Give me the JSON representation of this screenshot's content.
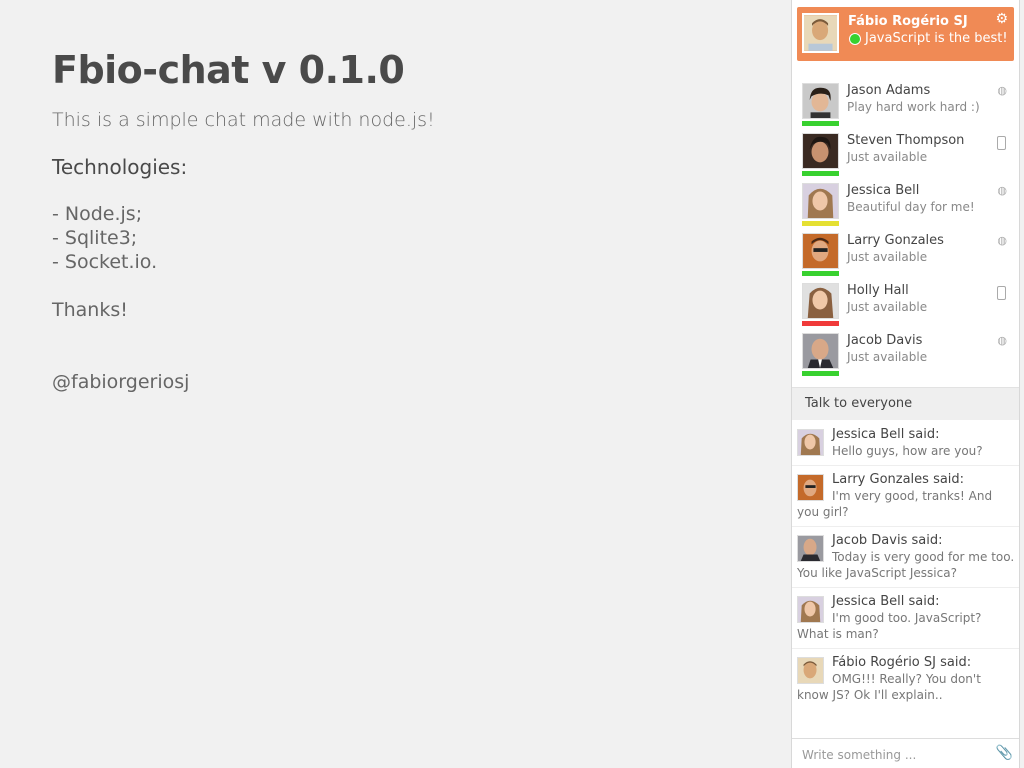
{
  "intro": {
    "title": "Fbio-chat v 0.1.0",
    "description": "This is a simple chat made with node.js!",
    "technologies_heading": "Technologies:",
    "technologies": [
      "- Node.js;",
      "- Sqlite3;",
      "- Socket.io."
    ],
    "thanks": "Thanks!",
    "handle": "@fabiorgeriosj"
  },
  "me": {
    "name": "Fábio Rogério SJ",
    "status": "JavaScript is the best!",
    "status_color": "#38d12f",
    "settings_icon": "gear-icon"
  },
  "contacts": [
    {
      "name": "Jason Adams",
      "status": "Play hard work hard :)",
      "bar_color": "#38d12f",
      "device": "globe-icon"
    },
    {
      "name": "Steven Thompson",
      "status": "Just available",
      "bar_color": "#38d12f",
      "device": "phone-icon"
    },
    {
      "name": "Jessica Bell",
      "status": "Beautiful day for me!",
      "bar_color": "#e5e032",
      "device": "globe-icon"
    },
    {
      "name": "Larry Gonzales",
      "status": "Just available",
      "bar_color": "#38d12f",
      "device": "globe-icon"
    },
    {
      "name": "Holly Hall",
      "status": "Just available",
      "bar_color": "#f03a3a",
      "device": "phone-icon"
    },
    {
      "name": "Jacob Davis",
      "status": "Just available",
      "bar_color": "#38d12f",
      "device": "globe-icon"
    }
  ],
  "talk_to_everyone": "Talk to everyone",
  "messages": [
    {
      "author": "Jessica Bell said:",
      "text": "Hello guys, how are you?"
    },
    {
      "author": "Larry Gonzales said:",
      "text": "I'm very good, tranks! And you girl?"
    },
    {
      "author": "Jacob Davis said:",
      "text": "Today is very good for me too. You like JavaScript Jessica?"
    },
    {
      "author": "Jessica Bell said:",
      "text": "I'm good too. JavaScript? What is man?"
    },
    {
      "author": "Fábio Rogério SJ said:",
      "text": "OMG!!! Really? You don't know JS? Ok I'll explain.."
    }
  ],
  "composer": {
    "placeholder": "Write something ...",
    "attach_icon": "paperclip-icon"
  },
  "colors": {
    "accent": "#f08a55",
    "online": "#38d12f",
    "away": "#e5e032",
    "busy": "#f03a3a"
  }
}
